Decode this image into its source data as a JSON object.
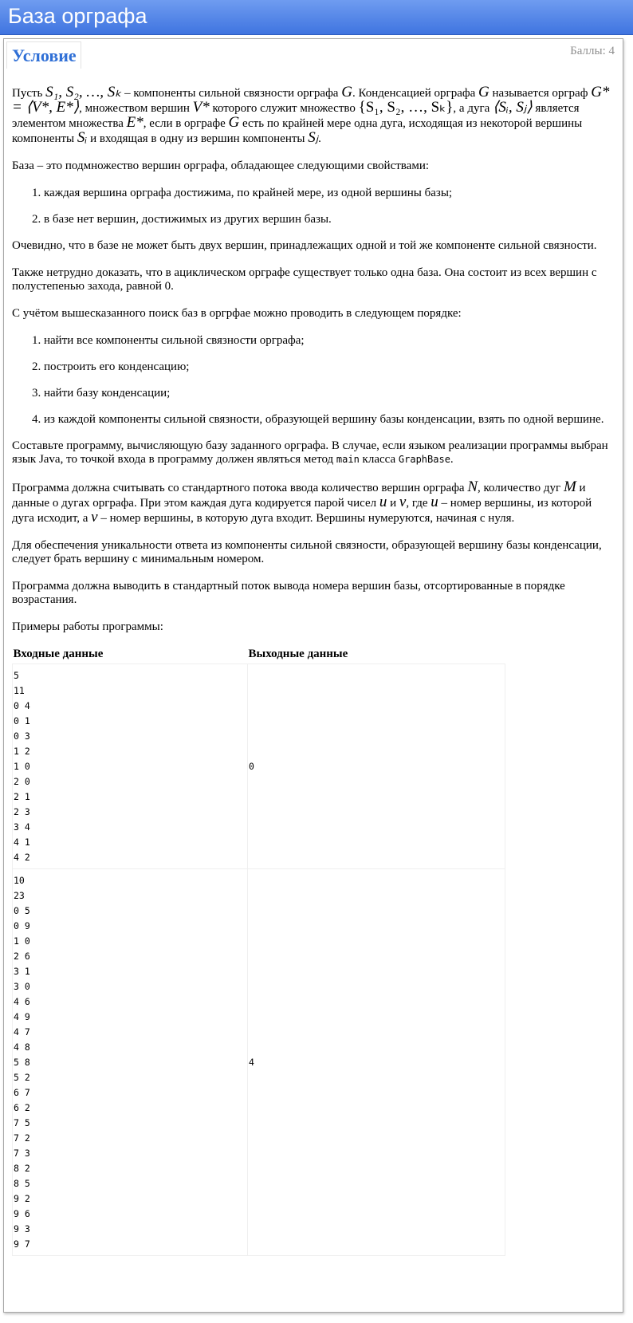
{
  "header": {
    "title": "База орграфа"
  },
  "panel": {
    "tab_title": "Условие",
    "score": "Баллы: 4"
  },
  "statement": {
    "p1": {
      "t1": "Пусть ",
      "m1": "S₁, S₂, …, Sₖ",
      "t2": " – компоненты сильной связности орграфа ",
      "m2": "G",
      "t3": ". Конденсацией орграфа ",
      "m3": "G",
      "t4": " называется орграф ",
      "m4": "G* = ⟨V*, E*⟩",
      "t5": ", множеством вершин ",
      "m5": "V*",
      "t6": " которого служит множество ",
      "m6": "{S₁, S₂, …, Sₖ}",
      "t7": ", а дуга ",
      "m7": "⟨Sᵢ, Sⱼ⟩",
      "t8": " является элементом множества ",
      "m8": "E*",
      "t9": ", если в орграфе ",
      "m9": "G",
      "t10": " есть по крайней мере одна дуга, исходящая из некоторой вершины компоненты ",
      "m10": "Sᵢ",
      "t11": " и входящая в одну из вершин компоненты ",
      "m11": "Sⱼ",
      "t12": "."
    },
    "p2": "База – это подмножество вершин орграфа, обладающее следующими свойствами:",
    "list1": [
      "каждая вершина орграфа достижима, по крайней мере, из одной вершины базы;",
      "в базе нет вершин, достижимых из других вершин базы."
    ],
    "p3": "Очевидно, что в базе не может быть двух вершин, принадлежащих одной и той же компоненте сильной связности.",
    "p4": "Также нетрудно доказать, что в ациклическом орграфе существует только одна база. Она состоит из всех вершин с полустепенью захода, равной 0.",
    "p5": "С учётом вышесказанного поиск баз в оргрфае можно проводить в следующем порядке:",
    "list2": [
      "найти все компоненты сильной связности орграфа;",
      "построить его конденсацию;",
      "найти базу конденсации;",
      "из каждой компоненты сильной связности, образующей вершину базы конденсации, взять по одной вершине."
    ],
    "p6": {
      "t1": "Составьте программу, вычисляющую базу заданного орграфа. В случае, если языком реализации программы выбран язык Java, то точкой входа в программу должен являться метод ",
      "c1": "main",
      "t2": " класса ",
      "c2": "GraphBase",
      "t3": "."
    },
    "p7": {
      "t1": "Программа должна считывать со стандартного потока ввода количество вершин орграфа ",
      "m1": "N",
      "t2": ", количество дуг ",
      "m2": "M",
      "t3": " и данные о дугах орграфа. При этом каждая дуга кодируется парой чисел ",
      "m3": "u",
      "t4": " и ",
      "m4": "v",
      "t5": ", где ",
      "m5": "u",
      "t6": " – номер вершины, из которой дуга исходит, а ",
      "m6": "v",
      "t7": " – номер вершины, в которую дуга входит. Вершины нумеруются, начиная с нуля."
    },
    "p8": "Для обеспечения уникальности ответа из компоненты сильной связности, образующей вершину базы конденсации, следует брать вершину с минимальным номером.",
    "p9": "Программа должна выводить в стандартный поток вывода номера вершин базы, отсортированные в порядке возрастания.",
    "p10": "Примеры работы программы:"
  },
  "examples": {
    "head_in": "Входные данные",
    "head_out": "Выходные данные",
    "ex1_in": "5\n11\n0 4\n0 1\n0 3\n1 2\n1 0\n2 0\n2 1\n2 3\n3 4\n4 1\n4 2",
    "ex1_out": "0",
    "ex2_in": "10\n23\n0 5\n0 9\n1 0\n2 6\n3 1\n3 0\n4 6\n4 9\n4 7\n4 8\n5 8\n5 2\n6 7\n6 2\n7 5\n7 2\n7 3\n8 2\n8 5\n9 2\n9 6\n9 3\n9 7",
    "ex2_out": "4"
  }
}
